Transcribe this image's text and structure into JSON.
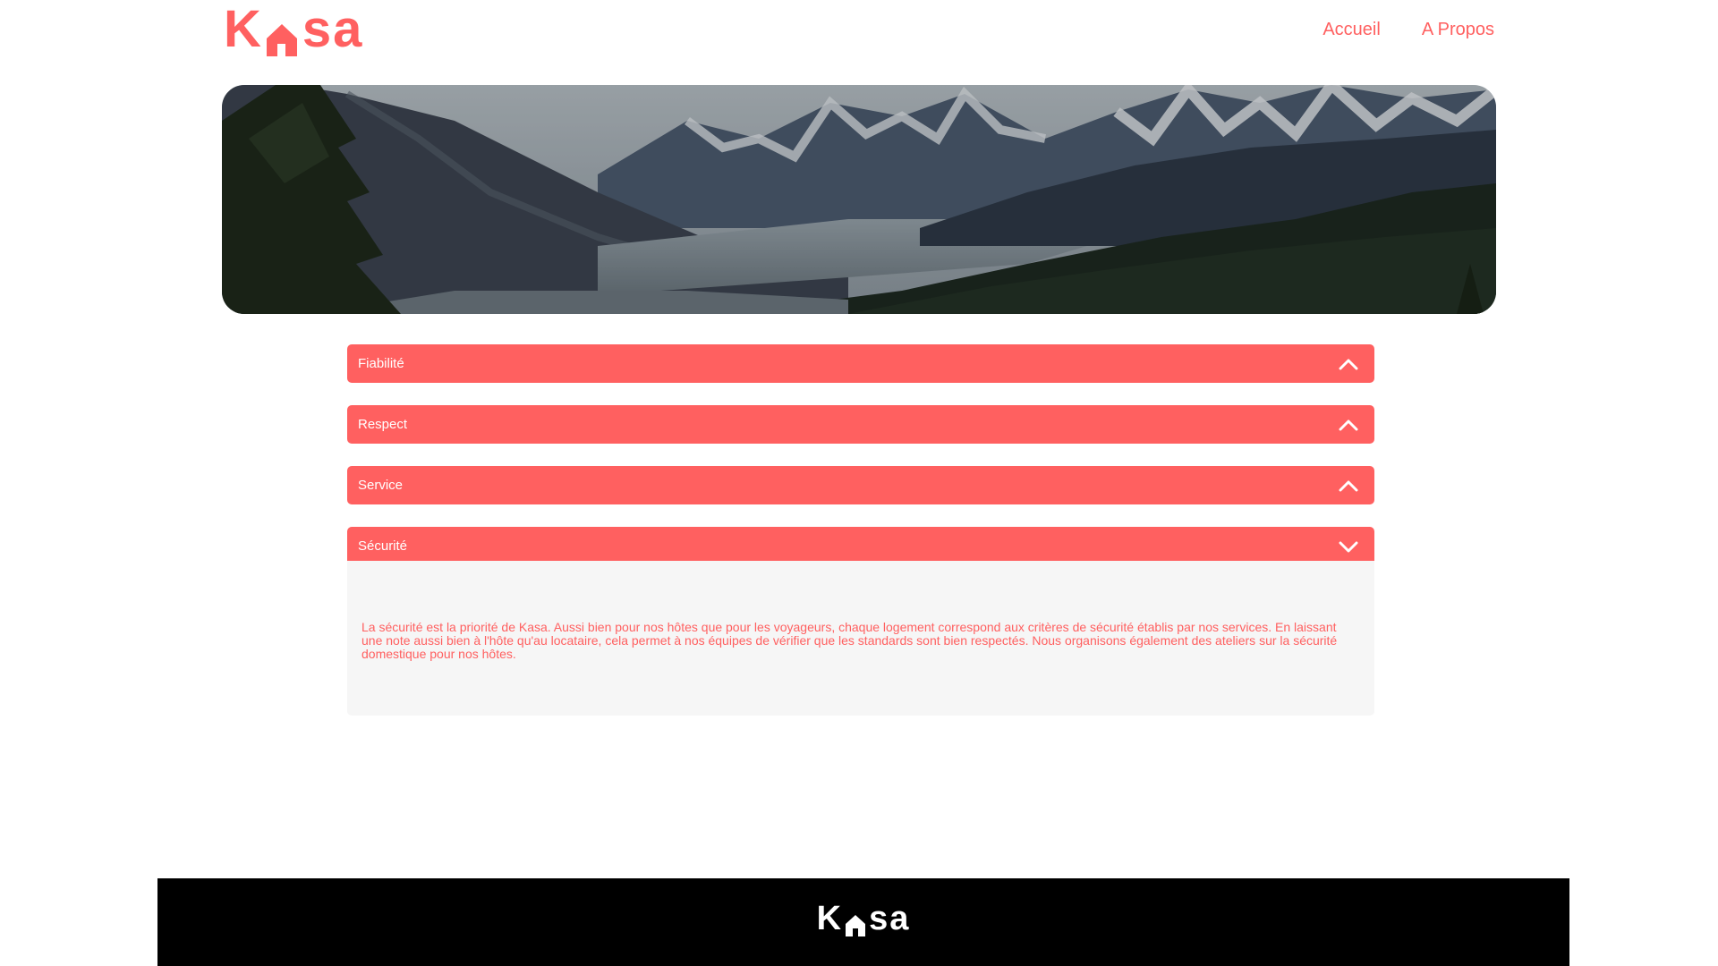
{
  "header": {
    "logo": {
      "part1": "K",
      "part2": "sa"
    },
    "nav": [
      {
        "label": "Accueil"
      },
      {
        "label": "A Propos"
      }
    ]
  },
  "banner": {
    "alt": ""
  },
  "collapses": [
    {
      "title": "Fiabilité",
      "open": false,
      "chevron_icon": "chevron-up-icon"
    },
    {
      "title": "Respect",
      "open": false,
      "chevron_icon": "chevron-up-icon"
    },
    {
      "title": "Service",
      "open": false,
      "chevron_icon": "chevron-up-icon"
    },
    {
      "title": "Sécurité",
      "open": true,
      "chevron_icon": "chevron-down-icon",
      "content": "La sécurité est la priorité de Kasa. Aussi bien pour nos hôtes que pour les voyageurs, chaque logement correspond aux critères de sécurité établis par nos services. En laissant une note aussi bien à l'hôte qu'au locataire, cela permet à nos équipes de vérifier que les standards sont bien respectés. Nous organisons également des ateliers sur la sécurité domestique pour nos hôtes."
    }
  ],
  "footer": {
    "logo": {
      "part1": "K",
      "part2": "sa"
    }
  },
  "colors": {
    "brand": "#FF6060",
    "panel_bg": "#F6F6F6",
    "footer_bg": "#000000"
  }
}
